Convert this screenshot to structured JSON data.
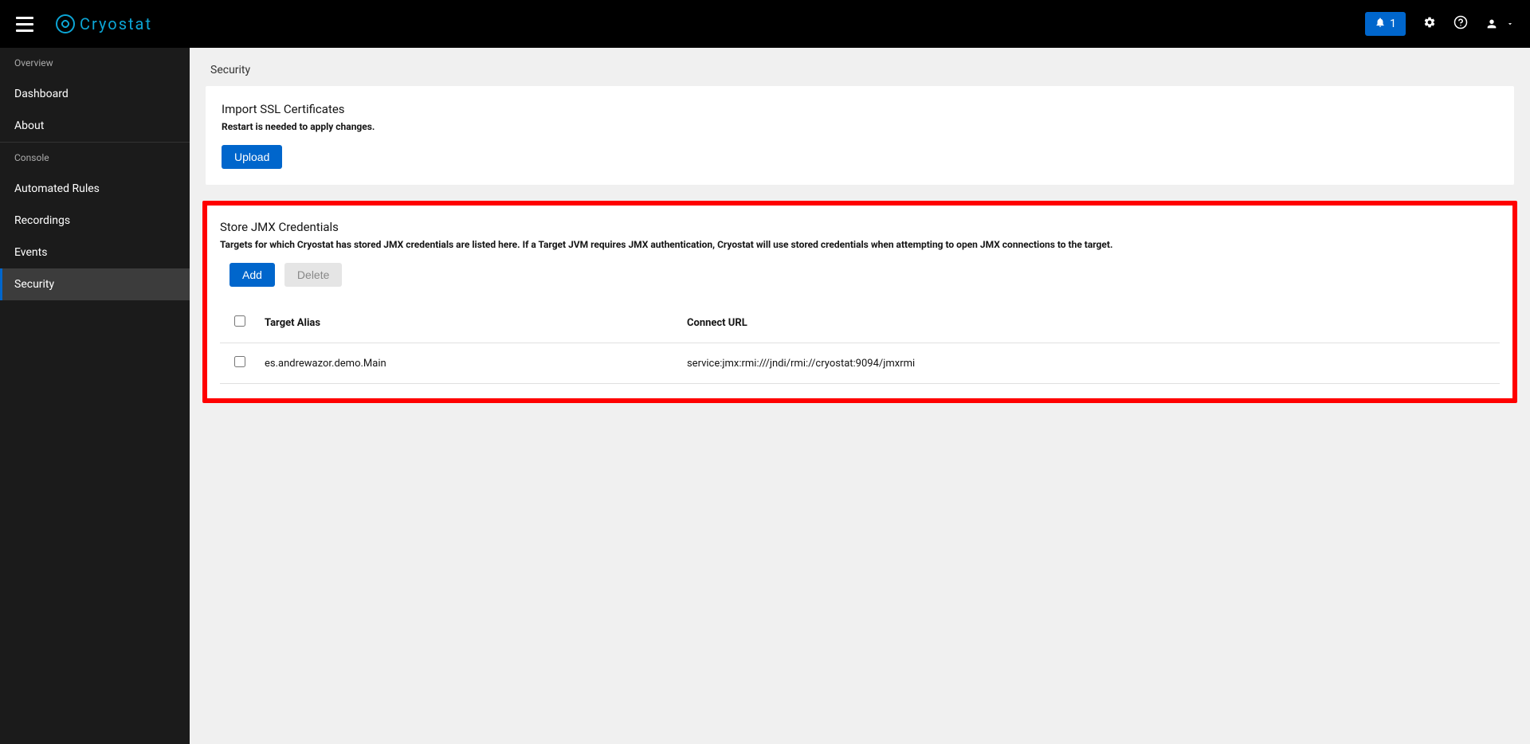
{
  "header": {
    "brand": "Cryostat",
    "notification_count": "1"
  },
  "sidebar": {
    "section_overview": "Overview",
    "section_console": "Console",
    "items": {
      "dashboard": "Dashboard",
      "about": "About",
      "automated_rules": "Automated Rules",
      "recordings": "Recordings",
      "events": "Events",
      "security": "Security"
    }
  },
  "page": {
    "title": "Security"
  },
  "ssl_card": {
    "title": "Import SSL Certificates",
    "subtext": "Restart is needed to apply changes.",
    "upload_btn": "Upload"
  },
  "jmx_card": {
    "title": "Store JMX Credentials",
    "subtext": "Targets for which Cryostat has stored JMX credentials are listed here. If a Target JVM requires JMX authentication, Cryostat will use stored credentials when attempting to open JMX connections to the target.",
    "add_btn": "Add",
    "delete_btn": "Delete",
    "columns": {
      "alias": "Target Alias",
      "url": "Connect URL"
    },
    "rows": [
      {
        "alias": "es.andrewazor.demo.Main",
        "url": "service:jmx:rmi:///jndi/rmi://cryostat:9094/jmxrmi"
      }
    ]
  }
}
